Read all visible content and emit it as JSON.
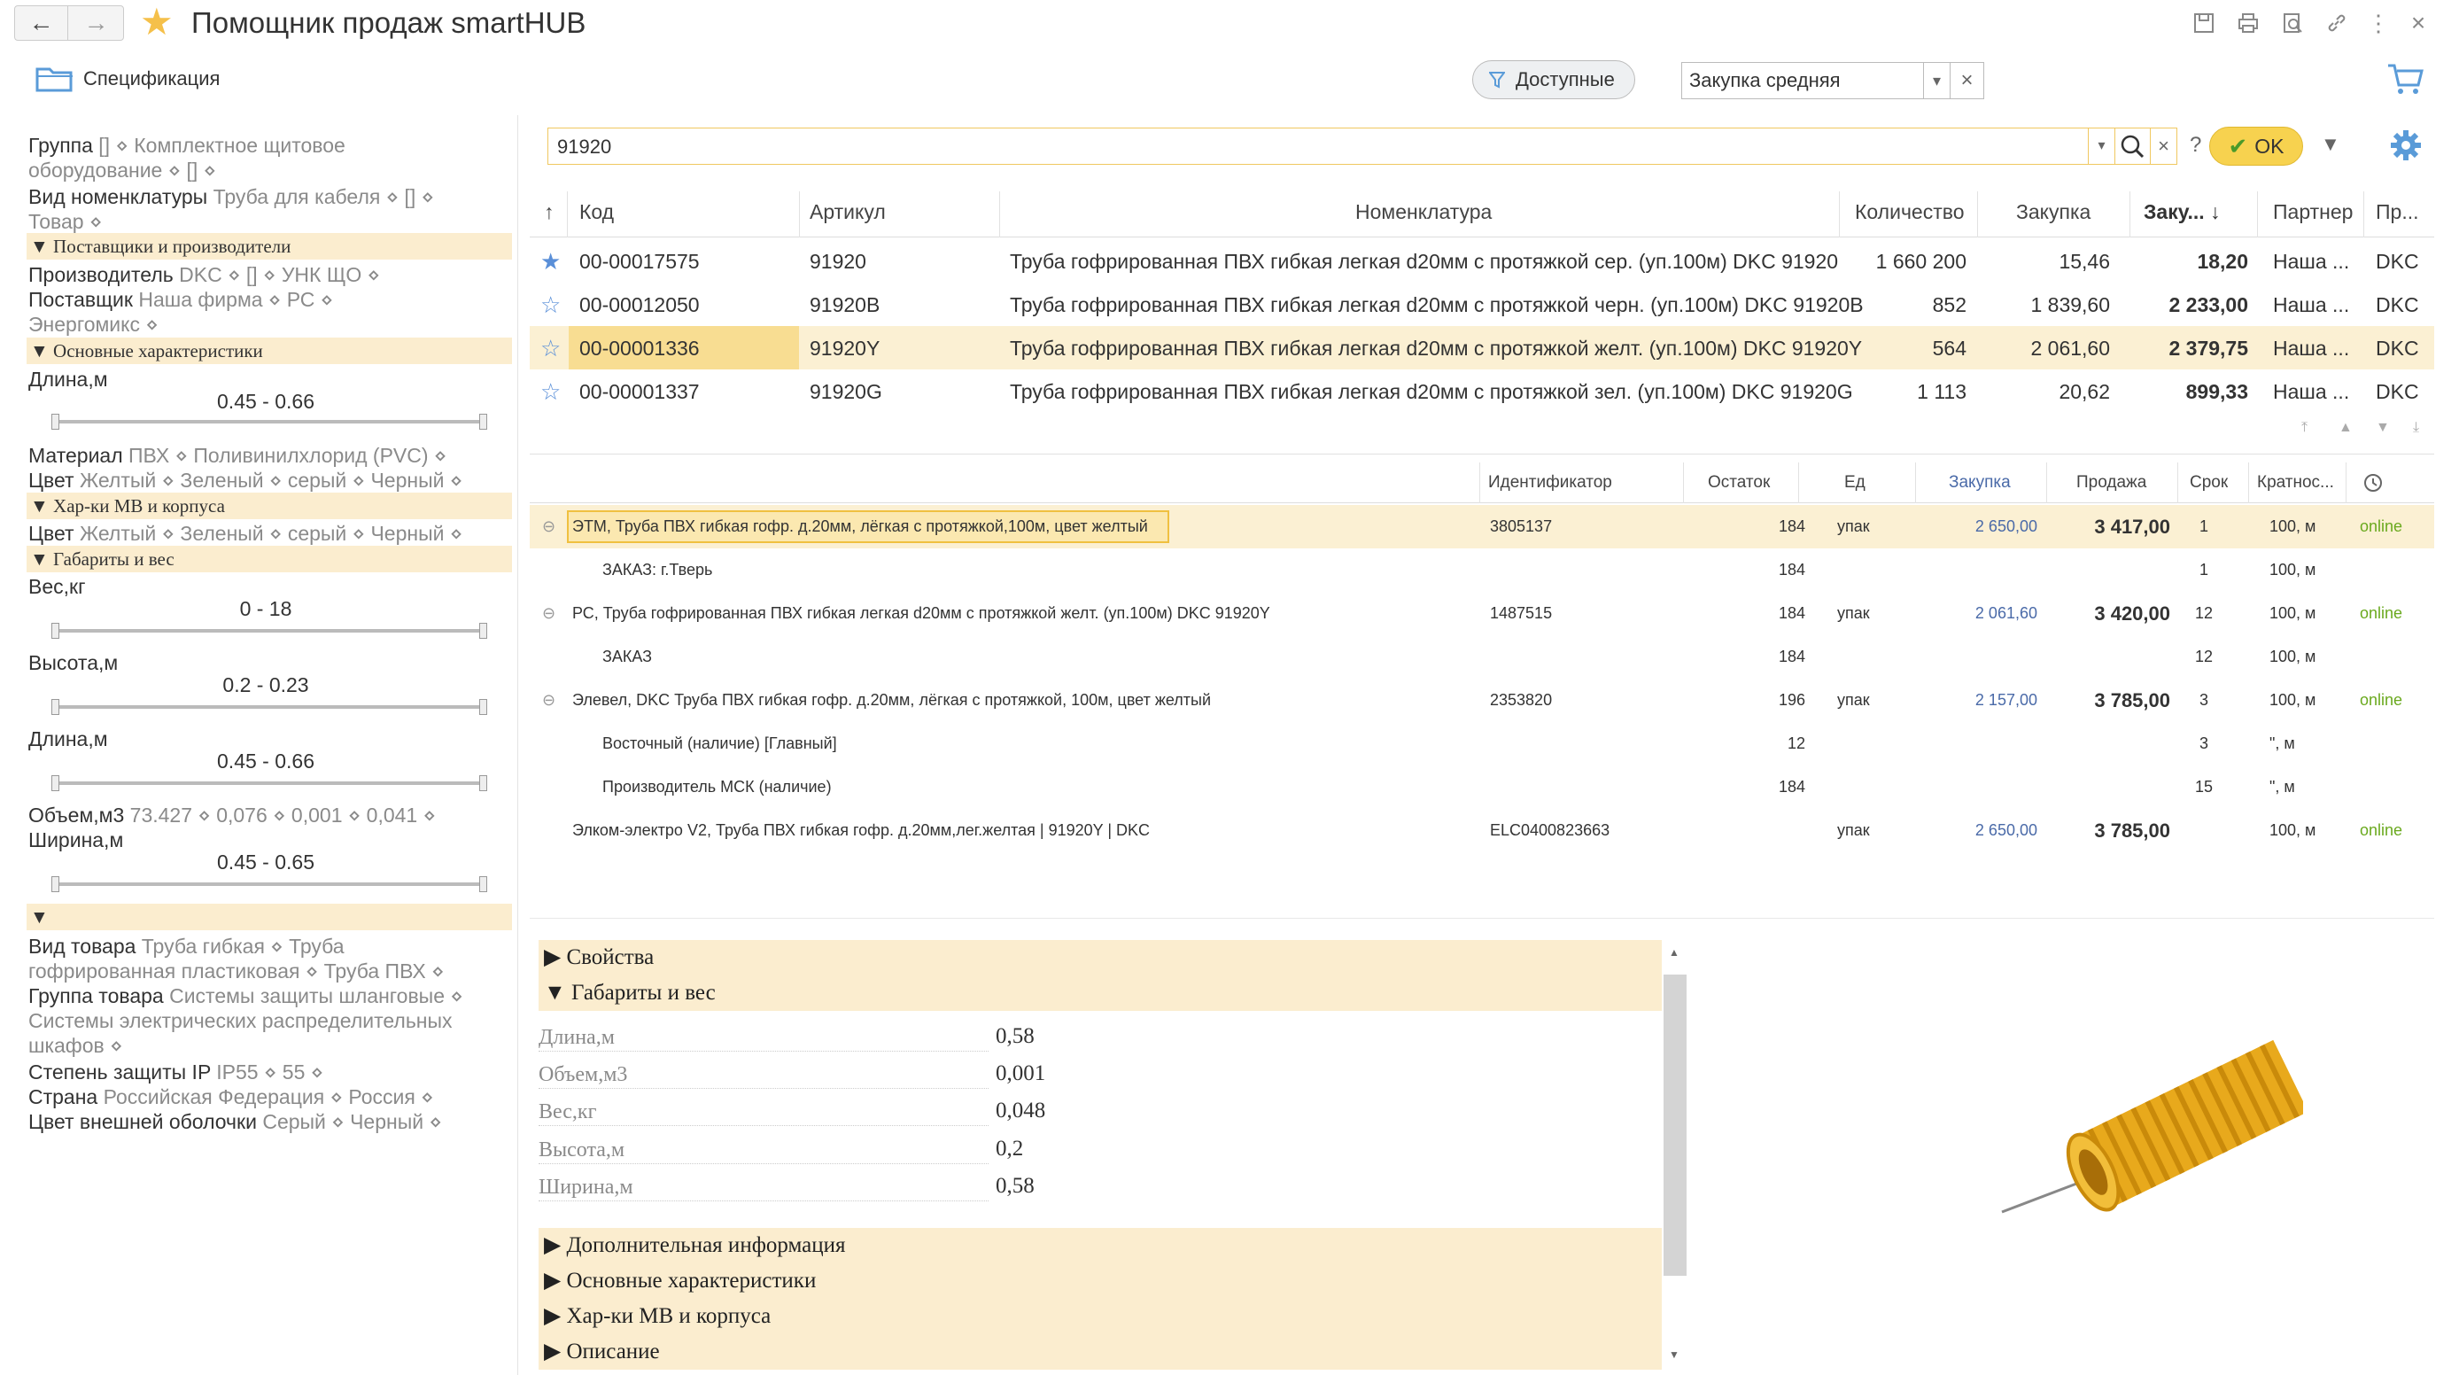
{
  "window": {
    "title": "Помощник продаж smartHUB",
    "nav_back": "←",
    "nav_forward": "→"
  },
  "toolbar": {
    "spec_label": "Спецификация",
    "filter_label": "Доступные",
    "price_type": "Закупка средняя",
    "clear": "×",
    "dropdown": "▾"
  },
  "search": {
    "query": "91920",
    "ok_label": "OK",
    "help": "?",
    "clear": "×"
  },
  "filters": {
    "group_label": "Группа",
    "group_value": "[]  ⋄  Комплектное щитовое",
    "group_value2": "оборудование  ⋄  []  ⋄",
    "kind_label": "Вид номенклатуры",
    "kind_value": "Труба для кабеля  ⋄  []  ⋄",
    "kind_value2": "Товар  ⋄",
    "sec_suppliers": "▼ Поставщики и производители",
    "maker_label": "Производитель",
    "maker_value": "DKC  ⋄  []  ⋄  УНК ЩО  ⋄",
    "supplier_label": "Поставщик",
    "supplier_value": "Наша фирма  ⋄  РС  ⋄",
    "supplier_value2": "Энергомикс  ⋄",
    "sec_main": "▼ Основные характеристики",
    "length_label": "Длина,м",
    "length_range": "0.45 - 0.66",
    "material_label": "Материал",
    "material_value": "ПВХ  ⋄  Поливинилхлорид (PVC)  ⋄",
    "color_label": "Цвет",
    "color_value": "Желтый  ⋄  Зеленый  ⋄  серый  ⋄  Черный  ⋄",
    "sec_mv": "▼ Хар-ки МВ и корпуса",
    "color2_label": "Цвет",
    "color2_value": "Желтый  ⋄  Зеленый  ⋄  серый  ⋄  Черный  ⋄",
    "sec_dims": "▼ Габариты и вес",
    "weight_label": "Вес,кг",
    "weight_range": "0 - 18",
    "height_label": "Высота,м",
    "height_range": "0.2 - 0.23",
    "length2_label": "Длина,м",
    "length2_range": "0.45 - 0.66",
    "volume_label": "Объем,м3",
    "volume_value": "73.427  ⋄  0,076  ⋄  0,001  ⋄  0,041  ⋄",
    "width_label": "Ширина,м",
    "width_range": "0.45 - 0.65",
    "sec_empty": "▼",
    "goods_kind_label": "Вид товара",
    "goods_kind_value": "Труба гибкая  ⋄  Труба",
    "goods_kind_value2": "гофрированная пластиковая  ⋄  Труба ПВХ  ⋄",
    "goods_group_label": "Группа товара",
    "goods_group_value": "Системы защиты шланговые  ⋄",
    "goods_group_value2": "Системы электрических распределительных",
    "goods_group_value3": "шкафов  ⋄",
    "ip_label": "Степень защиты IP",
    "ip_value": "IP55  ⋄  55  ⋄",
    "country_label": "Страна",
    "country_value": "Российская Федерация  ⋄  Россия  ⋄",
    "shell_label": "Цвет внешней оболочки",
    "shell_value": "Серый  ⋄  Черный  ⋄"
  },
  "main_table": {
    "headers": {
      "sort": "↑",
      "code": "Код",
      "article": "Артикул",
      "name": "Номенклатура",
      "qty": "Количество",
      "purchase": "Закупка",
      "purchase2": "Заку...  ↓",
      "partner": "Партнер",
      "pr": "Пр..."
    },
    "rows": [
      {
        "code": "00-00017575",
        "article": "91920",
        "name": "Труба гофрированная ПВХ гибкая легкая d20мм с протяжкой сер. (уп.100м) DKC 91920",
        "qty": "1 660 200",
        "purchase": "15,46",
        "purchase2": "18,20",
        "partner": "Наша ...",
        "pr": "DKC"
      },
      {
        "code": "00-00012050",
        "article": "91920B",
        "name": "Труба гофрированная ПВХ гибкая легкая d20мм с протяжкой черн. (уп.100м) DKC 91920B",
        "qty": "852",
        "purchase": "1 839,60",
        "purchase2": "2 233,00",
        "partner": "Наша ...",
        "pr": "DKC"
      },
      {
        "code": "00-00001336",
        "article": "91920Y",
        "name": "Труба гофрированная ПВХ гибкая легкая d20мм с протяжкой желт. (уп.100м) DKC 91920Y",
        "qty": "564",
        "purchase": "2 061,60",
        "purchase2": "2 379,75",
        "partner": "Наша ...",
        "pr": "DKC"
      },
      {
        "code": "00-00001337",
        "article": "91920G",
        "name": "Труба гофрированная ПВХ гибкая легкая d20мм с протяжкой зел. (уп.100м) DKC 91920G",
        "qty": "1 113",
        "purchase": "20,62",
        "purchase2": "899,33",
        "partner": "Наша ...",
        "pr": "DKC"
      }
    ]
  },
  "supplier_table": {
    "headers": {
      "ident": "Идентификатор",
      "stock": "Остаток",
      "unit": "Ед",
      "purchase": "Закупка",
      "sale": "Продажа",
      "term": "Срок",
      "mult": "Кратнос..."
    },
    "rows": [
      {
        "toggle": "⊖",
        "name": "ЭТМ, Труба ПВХ гибкая гофр. д.20мм, лёгкая с протяжкой,100м, цвет желтый",
        "ident": "3805137",
        "stock": "184",
        "unit": "упак",
        "purchase": "2 650,00",
        "sale": "3 417,00",
        "term": "1",
        "mult": "100, м",
        "status": "online"
      },
      {
        "toggle": "",
        "name": "ЗАКАЗ: г.Тверь",
        "ident": "",
        "stock": "184",
        "unit": "",
        "purchase": "",
        "sale": "",
        "term": "1",
        "mult": "100, м",
        "status": ""
      },
      {
        "toggle": "⊖",
        "name": "РС, Труба гофрированная ПВХ гибкая легкая d20мм с протяжкой желт. (уп.100м) DKC 91920Y",
        "ident": "1487515",
        "stock": "184",
        "unit": "упак",
        "purchase": "2 061,60",
        "sale": "3 420,00",
        "term": "12",
        "mult": "100, м",
        "status": "online"
      },
      {
        "toggle": "",
        "name": "ЗАКАЗ",
        "ident": "",
        "stock": "184",
        "unit": "",
        "purchase": "",
        "sale": "",
        "term": "12",
        "mult": "100, м",
        "status": ""
      },
      {
        "toggle": "⊖",
        "name": "Элевел, DKC Труба ПВХ гибкая гофр. д.20мм, лёгкая с протяжкой, 100м, цвет желтый",
        "ident": "2353820",
        "stock": "196",
        "unit": "упак",
        "purchase": "2 157,00",
        "sale": "3 785,00",
        "term": "3",
        "mult": "100, м",
        "status": "online"
      },
      {
        "toggle": "",
        "name": "Восточный (наличие) [Главный]",
        "ident": "",
        "stock": "12",
        "unit": "",
        "purchase": "",
        "sale": "",
        "term": "3",
        "mult": "\", м",
        "status": ""
      },
      {
        "toggle": "",
        "name": "Производитель МСК (наличие)",
        "ident": "",
        "stock": "184",
        "unit": "",
        "purchase": "",
        "sale": "",
        "term": "15",
        "mult": "\", м",
        "status": ""
      },
      {
        "toggle": "",
        "name": "Элком-электро V2, Труба ПВХ гибкая гофр. д.20мм,лег.желтая | 91920Y | DKC",
        "ident": "ELC0400823663",
        "stock": "",
        "unit": "упак",
        "purchase": "2 650,00",
        "sale": "3 785,00",
        "term": "",
        "mult": "100, м",
        "status": "online"
      }
    ]
  },
  "details": {
    "props": "▶  Свойства",
    "dims": "▼  Габариты и вес",
    "fields": [
      {
        "label": "Длина,м",
        "value": "0,58"
      },
      {
        "label": "Объем,м3",
        "value": "0,001"
      },
      {
        "label": "Вес,кг",
        "value": "0,048"
      },
      {
        "label": "Высота,м",
        "value": "0,2"
      },
      {
        "label": "Ширина,м",
        "value": "0,58"
      }
    ],
    "extra": "▶  Дополнительная информация",
    "main": "▶  Основные характеристики",
    "mv": "▶  Хар-ки МВ и корпуса",
    "desc": "▶  Описание"
  },
  "colors": {
    "accent": "#f5c04a",
    "selected_row": "#fbf0d3",
    "section_bg": "#fbedcf",
    "link": "#4a6aa8",
    "online": "#6aa91e",
    "star": "#5a8fd8"
  }
}
